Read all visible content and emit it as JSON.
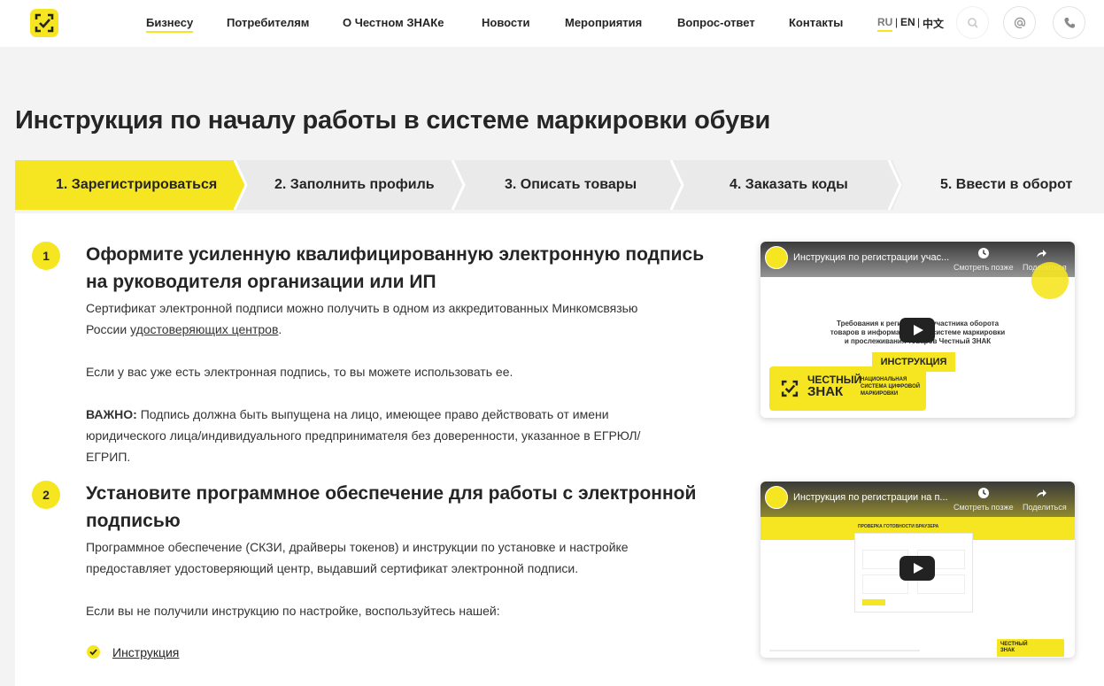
{
  "header": {
    "nav": [
      "Бизнесу",
      "Потребителям",
      "О Честном ЗНАКе",
      "Новости",
      "Мероприятия",
      "Вопрос-ответ",
      "Контакты"
    ],
    "languages": [
      "RU",
      "EN",
      "中文"
    ]
  },
  "page_title": "Инструкция по началу работы в системе маркировки обуви",
  "steps": [
    "1. Зарегистрироваться",
    "2. Заполнить профиль",
    "3. Описать товары",
    "4. Заказать коды",
    "5. Ввести в оборот"
  ],
  "sections": [
    {
      "num": "1",
      "heading_line1": "Оформите усиленную квалифицированную электронную подпись",
      "heading_line2": "на руководителя организации или ИП",
      "p1_line1": "Сертификат электронной подписи можно получить в одном из аккредитованных Минкомсвязью",
      "p1_line2_before": "России ",
      "p1_link": "удостоверяющих центров",
      "p1_line2_after": ".",
      "p2": "Если у вас уже есть электронная подпись, то вы можете использовать ее.",
      "p3_bold": "ВАЖНО:",
      "p3_line1": " Подпись должна быть выпущена на лицо, имеющее право действовать от имени",
      "p3_line2": "юридического лица/индивидуального предпринимателя без доверенности, указанное в ЕГРЮЛ/",
      "p3_line3": "ЕГРИП."
    },
    {
      "num": "2",
      "heading_line1": "Установите программное обеспечение для работы с электронной",
      "heading_line2": "подписью",
      "p1_line1": "Программное обеспечение (СКЗИ, драйверы токенов) и инструкции по установке и настройке",
      "p1_line2": "предоставляет удостоверяющий центр, выдавший сертификат электронной подписи.",
      "p2": "Если вы не получили инструкцию по настройке, воспользуйтесь нашей:",
      "link": "Инструкция"
    }
  ],
  "videos": [
    {
      "title": "Инструкция по регистрации учас...",
      "watch_later": "Смотреть позже",
      "share": "Поделиться",
      "caption_line1": "Требования к регистрации участника оборота",
      "caption_line2": "товаров в информационной системе маркировки",
      "caption_line3": "и прослеживания товаров Честный ЗНАК",
      "badge": "ИНСТРУКЦИЯ",
      "brand_line1": "ЧЕСТНЫЙ",
      "brand_line2": "ЗНАК",
      "brand_sub1": "НАЦИОНАЛЬНАЯ",
      "brand_sub2": "СИСТЕМА ЦИФРОВОЙ",
      "brand_sub3": "МАРКИРОВКИ"
    },
    {
      "title": "Инструкция по регистрации на п...",
      "watch_later": "Смотреть позже",
      "share": "Поделиться",
      "screen_title": "ПРОВЕРКА ГОТОВНОСТИ БРАУЗЕРА",
      "brand_line1": "ЧЕСТНЫЙ",
      "brand_line2": "ЗНАК"
    }
  ],
  "colors": {
    "accent": "#f6e521",
    "text": "#252525",
    "bg": "#f3f3f3"
  }
}
